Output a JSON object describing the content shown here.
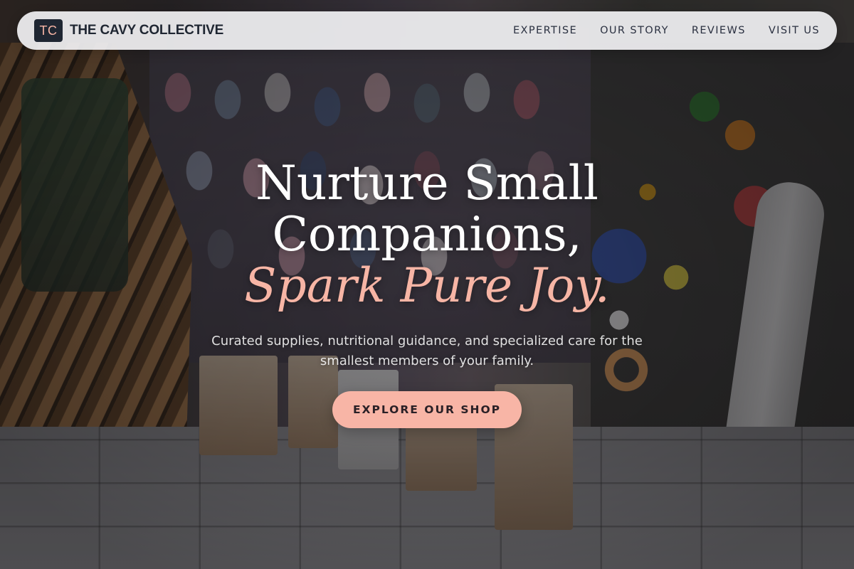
{
  "navbar": {
    "logo_initials": "TC",
    "brand_name": "THE CAVY COLLECTIVE",
    "links": [
      {
        "label": "EXPERTISE"
      },
      {
        "label": "OUR STORY"
      },
      {
        "label": "REVIEWS"
      },
      {
        "label": "VISIT US"
      }
    ]
  },
  "hero": {
    "headline_line1": "Nurture Small",
    "headline_line2": "Companions,",
    "headline_accent": "Spark Pure Joy.",
    "subtitle": "Curated supplies, nutritional guidance, and specialized care for the smallest members of your family.",
    "cta_label": "EXPLORE OUR SHOP",
    "background_image": "pet store interior with hanging small-pet clothing, toys, and pet food bags"
  },
  "colors": {
    "accent": "#f8b5a6",
    "logo_bg": "#1f2632",
    "navbar_bg": "#f2f2f4",
    "headline_text": "#ffffff"
  },
  "icons": {
    "logo": "tc-monogram-logo-icon"
  }
}
